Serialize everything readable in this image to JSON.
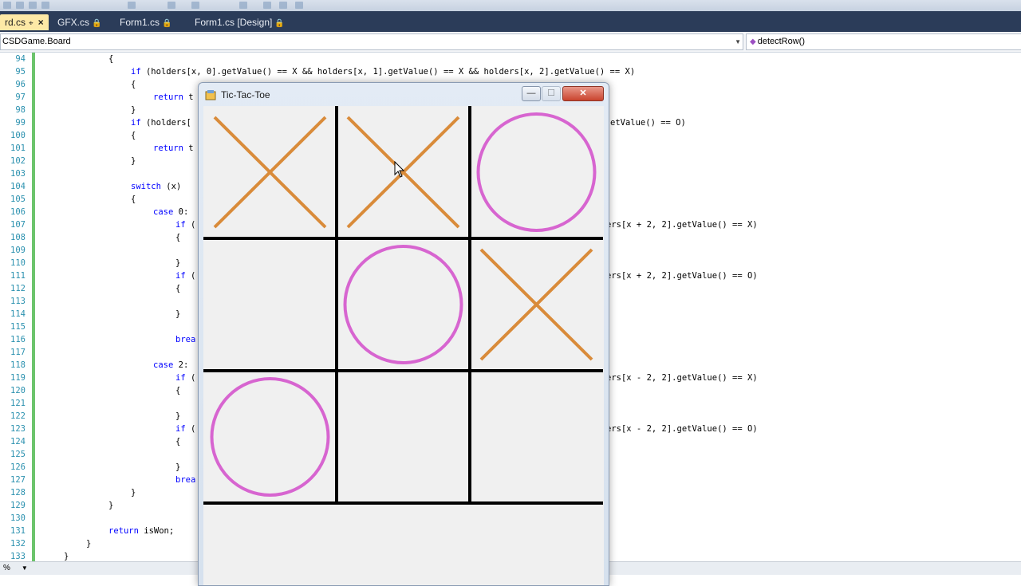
{
  "ide": {
    "tabs": [
      {
        "label": "rd.cs",
        "pin": "⌖",
        "close": "×",
        "active": true
      },
      {
        "label": "GFX.cs",
        "lock": "🔒",
        "active": false
      },
      {
        "label": "Form1.cs",
        "lock": "🔒",
        "active": false
      },
      {
        "label": "Form1.cs [Design]",
        "lock": "🔒",
        "active": false
      }
    ],
    "nav_left": "CSDGame.Board",
    "nav_right": "detectRow()",
    "status_zoom": "%",
    "code_lines": [
      {
        "n": "94",
        "text": "{"
      },
      {
        "n": "95",
        "text": "if (holders[x, 0].getValue() == X && holders[x, 1].getValue() == X && holders[x, 2].getValue() == X)"
      },
      {
        "n": "96",
        "text": "{"
      },
      {
        "n": "97",
        "text": "return t"
      },
      {
        "n": "98",
        "text": "}"
      },
      {
        "n": "99",
        "text": "if (holders[",
        "right": "etValue() == O)"
      },
      {
        "n": "100",
        "text": "{"
      },
      {
        "n": "101",
        "text": "return t"
      },
      {
        "n": "102",
        "text": "}"
      },
      {
        "n": "103",
        "text": ""
      },
      {
        "n": "104",
        "text": "switch (x)"
      },
      {
        "n": "105",
        "text": "{"
      },
      {
        "n": "106",
        "text": "case 0:"
      },
      {
        "n": "107",
        "text": "if (",
        "right": "ers[x + 2, 2].getValue() == X)"
      },
      {
        "n": "108",
        "text": "{"
      },
      {
        "n": "109",
        "text": ""
      },
      {
        "n": "110",
        "text": "}"
      },
      {
        "n": "111",
        "text": "if (",
        "right": "ers[x + 2, 2].getValue() == O)"
      },
      {
        "n": "112",
        "text": "{"
      },
      {
        "n": "113",
        "text": ""
      },
      {
        "n": "114",
        "text": "}"
      },
      {
        "n": "115",
        "text": ""
      },
      {
        "n": "116",
        "text": "brea"
      },
      {
        "n": "117",
        "text": ""
      },
      {
        "n": "118",
        "text": "case 2:"
      },
      {
        "n": "119",
        "text": "if (",
        "right": "ers[x - 2, 2].getValue() == X)"
      },
      {
        "n": "120",
        "text": "{"
      },
      {
        "n": "121",
        "text": ""
      },
      {
        "n": "122",
        "text": "}"
      },
      {
        "n": "123",
        "text": "if (",
        "right": "ers[x - 2, 2].getValue() == O)"
      },
      {
        "n": "124",
        "text": "{"
      },
      {
        "n": "125",
        "text": ""
      },
      {
        "n": "126",
        "text": "}"
      },
      {
        "n": "127",
        "text": "brea"
      },
      {
        "n": "128",
        "text": "}"
      },
      {
        "n": "129",
        "text": "}"
      },
      {
        "n": "130",
        "text": ""
      },
      {
        "n": "131",
        "text": "return isWon;"
      },
      {
        "n": "132",
        "text": "}"
      },
      {
        "n": "133",
        "text": "}"
      }
    ]
  },
  "game_window": {
    "title": "Tic-Tac-Toe",
    "minimize_glyph": "—",
    "maximize_glyph": "☐",
    "close_glyph": "✕",
    "x_color": "#d98b3a",
    "o_color": "#d765d0",
    "grid_color": "#000000",
    "board": [
      [
        "X",
        "X",
        "O"
      ],
      [
        "",
        "O",
        "X"
      ],
      [
        "O",
        "",
        ""
      ]
    ]
  }
}
